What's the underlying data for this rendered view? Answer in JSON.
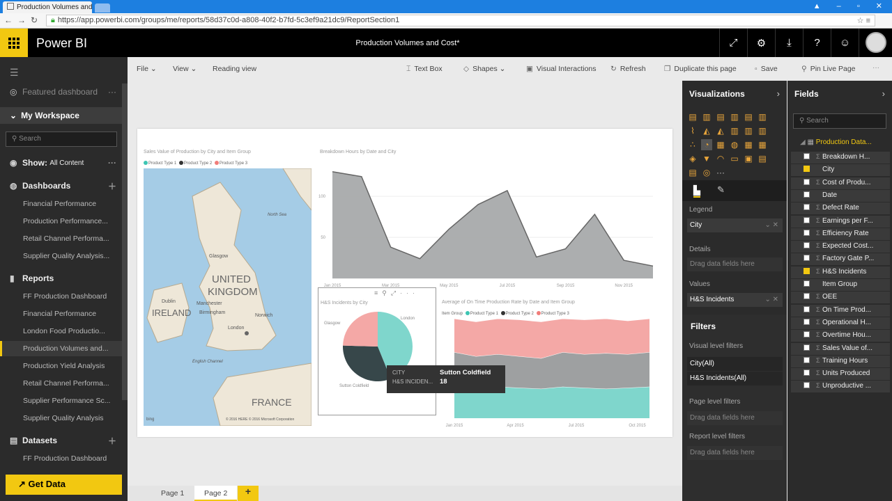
{
  "browser": {
    "tab_title": "Production Volumes and C",
    "url": "https://app.powerbi.com/groups/me/reports/58d37c0d-a808-40f2-b7fd-5c3ef9a21dc9/ReportSection1"
  },
  "header": {
    "brand": "Power BI",
    "report_title": "Production Volumes and Cost*"
  },
  "nav": {
    "featured": "Featured dashboard",
    "workspace": "My Workspace",
    "search_placeholder": "Search",
    "show_label": "Show:",
    "show_value": "All Content",
    "dashboards_label": "Dashboards",
    "dashboards": [
      "Financial Performance",
      "Production Performance...",
      "Retail Channel Performa...",
      "Supplier Quality Analysis..."
    ],
    "reports_label": "Reports",
    "reports": [
      "FF Production Dashboard",
      "Financial Performance",
      "London Food Productio...",
      "Production Volumes and...",
      "Production Yield Analysis",
      "Retail Channel Performa...",
      "Supplier Performance Sc...",
      "Supplier Quality Analysis"
    ],
    "datasets_label": "Datasets",
    "datasets": [
      "FF Production Dashboard"
    ],
    "get_data": "Get Data"
  },
  "toolbar": {
    "file": "File",
    "view": "View",
    "reading_view": "Reading view",
    "text_box": "Text Box",
    "shapes": "Shapes",
    "visual_interactions": "Visual Interactions",
    "refresh": "Refresh",
    "duplicate": "Duplicate this page",
    "save": "Save",
    "pin_live": "Pin Live Page"
  },
  "visuals": {
    "map_title": "Sales Value of Production by City and Item Group",
    "legend": [
      "Product Type 1",
      "Product Type 2",
      "Product Type 3"
    ],
    "legend_colors": [
      "#3dc5b3",
      "#333333",
      "#f07d7a"
    ],
    "area_title": "Breakdown Hours by Date and City",
    "pie_title": "H&S Incidents by City",
    "stack_title": "Average of On Time Production Rate by Date and Item Group",
    "stack_legend_label": "Item Group",
    "map_labels": {
      "uk1": "UNITED",
      "uk2": "KINGDOM",
      "ireland": "IRELAND",
      "france": "FRANCE",
      "glasgow": "Glasgow",
      "manchester": "Manchester",
      "birmingham": "Birmingham",
      "london": "London",
      "norwich": "Norwich",
      "dublin": "Dublin",
      "english_channel": "English Channel",
      "north_sea": "North Sea",
      "bing": "bing",
      "copyright": "© 2016 HERE  © 2016 Microsoft Corporation"
    }
  },
  "chart_data": [
    {
      "type": "area",
      "title": "Breakdown Hours by Date and City",
      "x": [
        "Jan 2015",
        "Feb 2015",
        "Mar 2015",
        "Apr 2015",
        "May 2015",
        "Jun 2015",
        "Jul 2015",
        "Aug 2015",
        "Sep 2015",
        "Oct 2015",
        "Nov 2015",
        "Dec 2015"
      ],
      "x_tick_labels": [
        "Jan 2015",
        "Mar 2015",
        "May 2015",
        "Jul 2015",
        "Sep 2015",
        "Nov 2015"
      ],
      "y_tick_labels": [
        "100",
        "50"
      ],
      "values": [
        130,
        124,
        38,
        24,
        60,
        90,
        107,
        26,
        36,
        78,
        22,
        15
      ],
      "ylim": [
        0,
        140
      ]
    },
    {
      "type": "pie",
      "title": "H&S Incidents by City",
      "categories": [
        "London",
        "Sutton Coldfield",
        "Glasgow"
      ],
      "values": [
        25,
        18,
        14
      ],
      "colors": [
        "#7fd6cc",
        "#37474a",
        "#f4a8a6"
      ]
    },
    {
      "type": "area",
      "title": "Average of On Time Production Rate by Date and Item Group",
      "stacked": true,
      "x_tick_labels": [
        "Jan 2015",
        "Apr 2015",
        "Jul 2015",
        "Oct 2015"
      ],
      "series": [
        {
          "name": "Product Type 1",
          "values": [
            0.3,
            0.28,
            0.31,
            0.3,
            0.29,
            0.31,
            0.3,
            0.29,
            0.3,
            0.31
          ]
        },
        {
          "name": "Product Type 2",
          "values": [
            0.35,
            0.33,
            0.32,
            0.31,
            0.3,
            0.34,
            0.33,
            0.35,
            0.33,
            0.34
          ]
        },
        {
          "name": "Product Type 3",
          "values": [
            0.33,
            0.34,
            0.35,
            0.36,
            0.36,
            0.33,
            0.34,
            0.34,
            0.33,
            0.33
          ]
        }
      ]
    }
  ],
  "tooltip": {
    "k1": "CITY",
    "v1": "Sutton Coldfield",
    "k2": "H&S INCIDEN...",
    "v2": "18"
  },
  "pages": [
    "Page 1",
    "Page 2"
  ],
  "viz_pane": {
    "title": "Visualizations",
    "legend_label": "Legend",
    "legend_value": "City",
    "details_label": "Details",
    "details_drop": "Drag data fields here",
    "values_label": "Values",
    "values_value": "H&S Incidents",
    "filters_title": "Filters",
    "visual_filters": "Visual level filters",
    "filter1": "City(All)",
    "filter2": "H&S Incidents(All)",
    "page_filters": "Page level filters",
    "page_drop": "Drag data fields here",
    "report_filters": "Report level filters",
    "report_drop": "Drag data fields here",
    "accent": "#f2c811"
  },
  "fields_pane": {
    "title": "Fields",
    "search_placeholder": "Search",
    "table": "Production Data...",
    "fields": [
      {
        "name": "Breakdown H...",
        "sigma": true,
        "checked": false
      },
      {
        "name": "City",
        "sigma": false,
        "checked": true
      },
      {
        "name": "Cost of Produ...",
        "sigma": true,
        "checked": false
      },
      {
        "name": "Date",
        "sigma": false,
        "checked": false
      },
      {
        "name": "Defect Rate",
        "sigma": true,
        "checked": false
      },
      {
        "name": "Earnings per F...",
        "sigma": true,
        "checked": false
      },
      {
        "name": "Efficiency Rate",
        "sigma": true,
        "checked": false
      },
      {
        "name": "Expected Cost...",
        "sigma": true,
        "checked": false
      },
      {
        "name": "Factory Gate P...",
        "sigma": true,
        "checked": false
      },
      {
        "name": "H&S Incidents",
        "sigma": true,
        "checked": true
      },
      {
        "name": "Item Group",
        "sigma": false,
        "checked": false
      },
      {
        "name": "OEE",
        "sigma": true,
        "checked": false
      },
      {
        "name": "On Time Prod...",
        "sigma": true,
        "checked": false
      },
      {
        "name": "Operational H...",
        "sigma": true,
        "checked": false
      },
      {
        "name": "Overtime Hou...",
        "sigma": true,
        "checked": false
      },
      {
        "name": "Sales Value of...",
        "sigma": true,
        "checked": false
      },
      {
        "name": "Training Hours",
        "sigma": true,
        "checked": false
      },
      {
        "name": "Units Produced",
        "sigma": true,
        "checked": false
      },
      {
        "name": "Unproductive ...",
        "sigma": true,
        "checked": false
      }
    ]
  }
}
